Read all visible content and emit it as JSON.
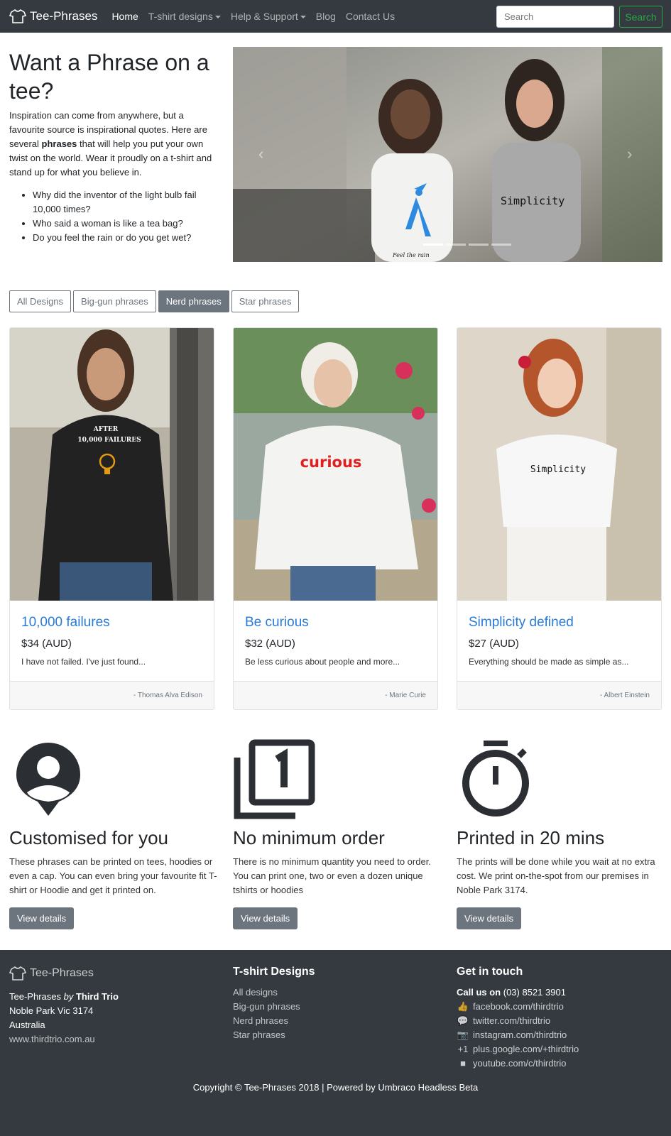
{
  "nav": {
    "brand": "Tee-Phrases",
    "items": [
      {
        "label": "Home"
      },
      {
        "label": "T-shirt designs"
      },
      {
        "label": "Help & Support"
      },
      {
        "label": "Blog"
      },
      {
        "label": "Contact Us"
      }
    ],
    "search_placeholder": "Search",
    "search_button": "Search"
  },
  "hero": {
    "title": "Want a Phrase on a tee?",
    "intro_before": "Inspiration can come from anywhere, but a favourite source is inspirational quotes. Here are several ",
    "intro_bold": "phrases",
    "intro_after": " that will help you put your own twist on the world. Wear it proudly on a t-shirt and stand up for what you believe in.",
    "bullets": [
      "Why did the inventor of the light bulb fail 10,000 times?",
      "Who said a woman is like a tea bag?",
      "Do you feel the rain or do you get wet?"
    ],
    "carousel": {
      "shirt1_caption": "Feel the rain",
      "shirt2_text": "Simplicity"
    }
  },
  "filters": [
    "All Designs",
    "Big-gun phrases",
    "Nerd phrases",
    "Star phrases"
  ],
  "cards": [
    {
      "title": "10,000 failures",
      "price": "$34 (AUD)",
      "text": "I have not failed. I've just found...",
      "author": "- Thomas Alva Edison",
      "print_line1": "AFTER",
      "print_line2": "10,000 FAILURES"
    },
    {
      "title": "Be curious",
      "price": "$32 (AUD)",
      "text": "Be less curious about people and more...",
      "author": "- Marie Curie",
      "print": "curious"
    },
    {
      "title": "Simplicity defined",
      "price": "$27 (AUD)",
      "text": "Everything should be made as simple as...",
      "author": "- Albert Einstein",
      "print": "Simplicity"
    }
  ],
  "features": [
    {
      "title": "Customised for you",
      "text": "These phrases can be printed on tees, hoodies or even a cap. You can even bring your favourite fit T-shirt or Hoodie and get it printed on.",
      "button": "View details",
      "icon": "user-location-icon"
    },
    {
      "title": "No minimum order",
      "text": "There is no minimum quantity you need to order. You can print one, two or even a dozen unique tshirts or hoodies",
      "button": "View details",
      "icon": "filter-one-icon"
    },
    {
      "title": "Printed in 20 mins",
      "text": "The prints will be done while you wait at no extra cost. We print on-the-spot from our premises in Noble Park 3174.",
      "button": "View details",
      "icon": "timer-icon"
    }
  ],
  "footer": {
    "brand": "Tee-Phrases",
    "about_prefix": "Tee-Phrases ",
    "about_by": "by",
    "about_company": " Third Trio",
    "address1": "Noble Park Vic 3174",
    "address2": "Australia",
    "website": "www.thirdtrio.com.au",
    "designs_heading": "T-shirt Designs",
    "designs_links": [
      "All designs",
      "Big-gun phrases",
      "Nerd phrases",
      "Star phrases"
    ],
    "contact_heading": "Get in touch",
    "call_label": "Call us on",
    "phone": "(03) 8521 3901",
    "social": [
      {
        "icon": "thumbs-up-icon",
        "glyph": "👍",
        "label": "facebook.com/thirdtrio"
      },
      {
        "icon": "chat-icon",
        "glyph": "💬",
        "label": "twitter.com/thirdtrio"
      },
      {
        "icon": "camera-icon",
        "glyph": "📷",
        "label": "instagram.com/thirdtrio"
      },
      {
        "icon": "plus-one-icon",
        "glyph": "+1",
        "label": "plus.google.com/+thirdtrio"
      },
      {
        "icon": "video-icon",
        "glyph": "■",
        "label": "youtube.com/c/thirdtrio"
      }
    ],
    "copyright": "Copyright © Tee-Phrases 2018 | Powered by Umbraco Headless Beta"
  },
  "colors": {
    "navbar": "#343a40",
    "link": "#2a7bd6",
    "success": "#28a745",
    "secondary": "#6c757d"
  }
}
